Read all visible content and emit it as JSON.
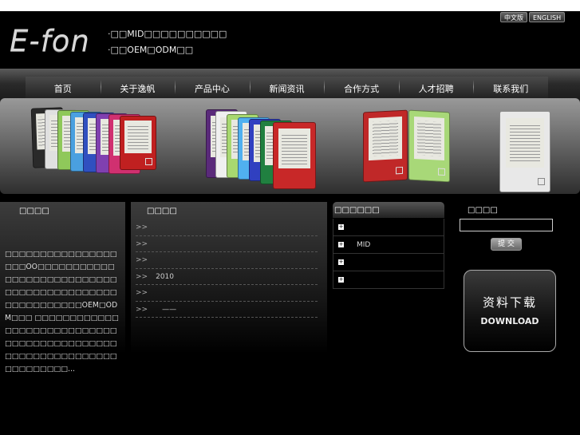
{
  "brand": {
    "logo_text": "E-fon"
  },
  "taglines": [
    "·□□MID□□□□□□□□□□",
    "·□□OEM□ODM□□"
  ],
  "language": {
    "cn_label": "中文版",
    "en_label": "ENGLISH"
  },
  "nav": {
    "items": [
      {
        "label": "首页"
      },
      {
        "label": "关于逸帆"
      },
      {
        "label": "产品中心"
      },
      {
        "label": "新闻资讯"
      },
      {
        "label": "合作方式"
      },
      {
        "label": "人才招聘"
      },
      {
        "label": "联系我们"
      }
    ]
  },
  "about": {
    "title": "□□□□",
    "text": "□□□□□□□□□□□□□□□□□□□OO□□□□□□□□□□□□□□□□□□□□□□□□□□□□□□□□□□□□□□□□□□□□□□□□□□□□□□OEM□ODM□□□ □□□□□□□□□□□□□□□□□□□□□□□□□□□□□□□□□□□□□□□□□□□□□□□□□□□□□□□□□□□□□□□□□□□□□..."
  },
  "news": {
    "title": "□□□□",
    "items": [
      {
        "arrow": ">>",
        "text": ""
      },
      {
        "arrow": ">>",
        "text": ""
      },
      {
        "arrow": ">>",
        "text": ""
      },
      {
        "arrow": ">>",
        "text": "2010"
      },
      {
        "arrow": ">>",
        "text": ""
      },
      {
        "arrow": ">>",
        "text": "——"
      }
    ]
  },
  "products": {
    "title": "□□□□□□",
    "items": [
      {
        "plus": "+",
        "text": ""
      },
      {
        "plus": "+",
        "text": "MID"
      },
      {
        "plus": "+",
        "text": ""
      },
      {
        "plus": "+",
        "text": ""
      }
    ]
  },
  "search": {
    "title": "□□□□",
    "input_value": "",
    "submit_label": "提 交"
  },
  "download": {
    "cn_label": "资料下载",
    "en_label": "DOWNLOAD"
  },
  "colors": {
    "background": "#000000",
    "text": "#ffffff",
    "accent_gray": "#888888"
  }
}
